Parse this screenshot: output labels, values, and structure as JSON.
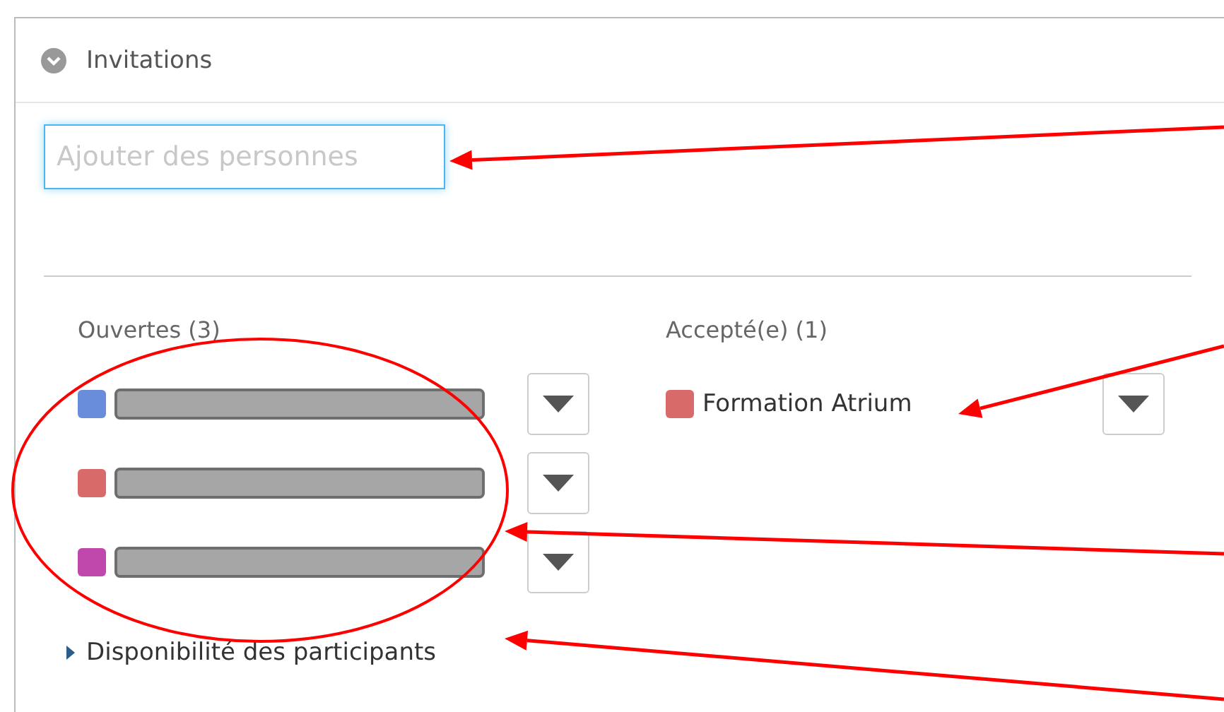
{
  "panel": {
    "title": "Invitations",
    "expanded": true
  },
  "add_field": {
    "placeholder": "Ajouter des personnes",
    "focused": true
  },
  "columns": [
    {
      "heading": "Ouvertes (3)",
      "people": [
        {
          "color": "#6a8ddb",
          "redacted": true
        },
        {
          "color": "#d96a6a",
          "redacted": true
        },
        {
          "color": "#c048ac",
          "redacted": true
        }
      ]
    },
    {
      "heading": "Accepté(e) (1)",
      "people": [
        {
          "color": "#d96a6a",
          "name": "Formation Atrium",
          "redacted": false
        }
      ]
    }
  ],
  "availability": {
    "label": "Disponibilité des participants",
    "expanded": false
  }
}
